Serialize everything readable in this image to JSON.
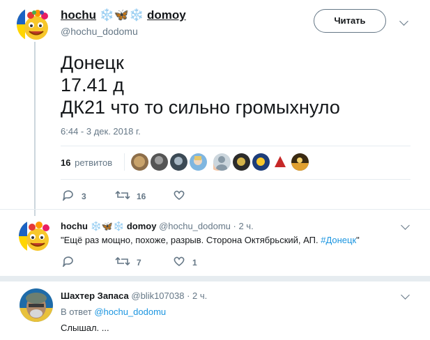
{
  "main_tweet": {
    "name_part1": "hochu",
    "emoji": "❄️🦋❄️",
    "name_part2": "domoy",
    "handle": "@hochu_dodomu",
    "follow_label": "Читать",
    "text_lines": [
      "Донецк",
      "17.41 д",
      "ДК21 что то сильно громыхнуло"
    ],
    "timestamp": "6:44 - 3 дек. 2018 г.",
    "retweets_count": "16",
    "retweets_label": "ретвитов",
    "reply_count": "3",
    "retweet_count": "16"
  },
  "reply1": {
    "name_part1": "hochu",
    "emoji": "❄️🦋❄️",
    "name_part2": "domoy",
    "handle": "@hochu_dodomu",
    "time": "· 2 ч.",
    "text_before": "\"Ещё раз мощно, похоже, разрыв.  Сторона Октябрьский, АП. ",
    "hashtag": "#Донецк",
    "text_after": "\"",
    "retweet_count": "7",
    "like_count": "1"
  },
  "reply2": {
    "name": "Шахтер Запаса",
    "handle": "@blik107038",
    "time": "· 2 ч.",
    "in_reply_prefix": "В ответ ",
    "in_reply_handle": "@hochu_dodomu",
    "text": "Слышал. ..."
  },
  "colors": {
    "link": "#1b95e0",
    "muted": "#657786",
    "text": "#14171a",
    "divider": "#e6ecf0"
  }
}
